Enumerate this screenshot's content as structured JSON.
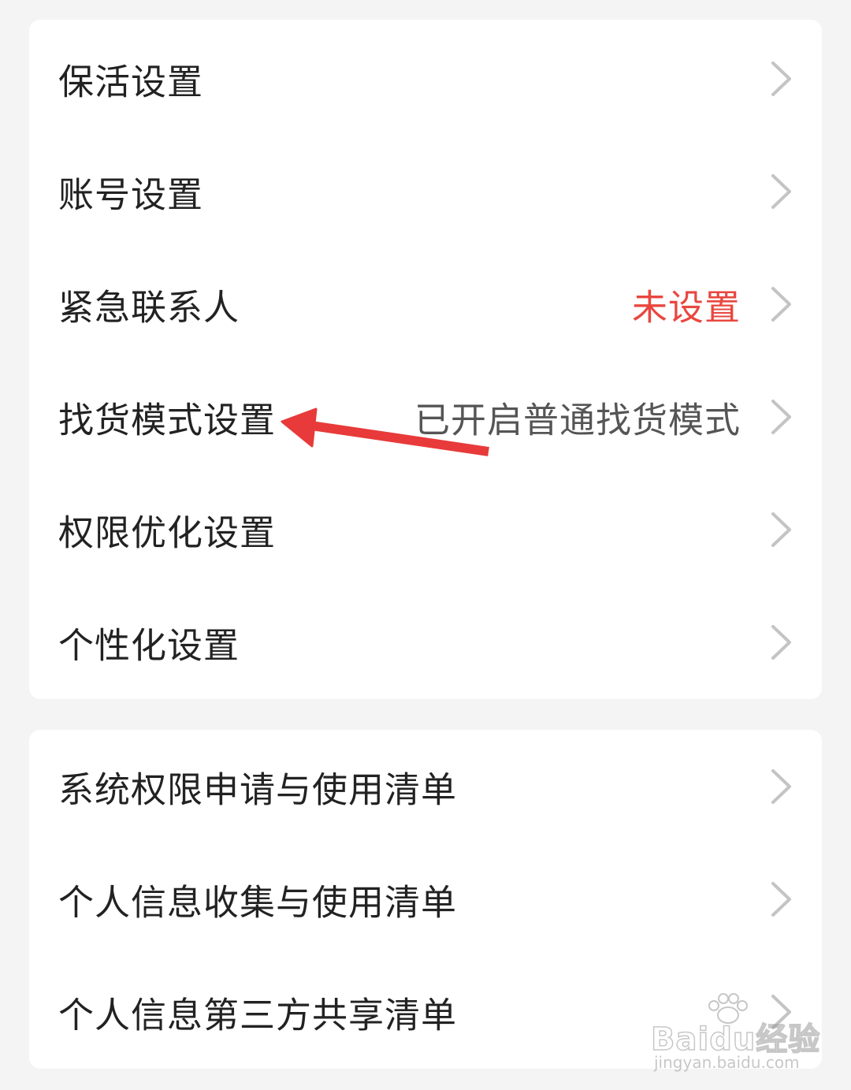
{
  "settings_group_1": [
    {
      "label": "保活设置",
      "value": ""
    },
    {
      "label": "账号设置",
      "value": ""
    },
    {
      "label": "紧急联系人",
      "value": "未设置",
      "value_color": "#e8473f"
    },
    {
      "label": "找货模式设置",
      "value": "已开启普通找货模式",
      "value_color": "#555555"
    },
    {
      "label": "权限优化设置",
      "value": ""
    },
    {
      "label": "个性化设置",
      "value": ""
    }
  ],
  "settings_group_2": [
    {
      "label": "系统权限申请与使用清单"
    },
    {
      "label": "个人信息收集与使用清单"
    },
    {
      "label": "个人信息第三方共享清单"
    }
  ],
  "annotation": {
    "type": "red-arrow",
    "color": "#e83a3a",
    "points_to": "找货模式设置"
  },
  "watermark": {
    "logo_text": "Baidu经验",
    "url": "jingyan.baidu.com"
  },
  "icons": {
    "row_chevron": "chevron-right-icon",
    "chevron_color": "#c4c4c4"
  }
}
